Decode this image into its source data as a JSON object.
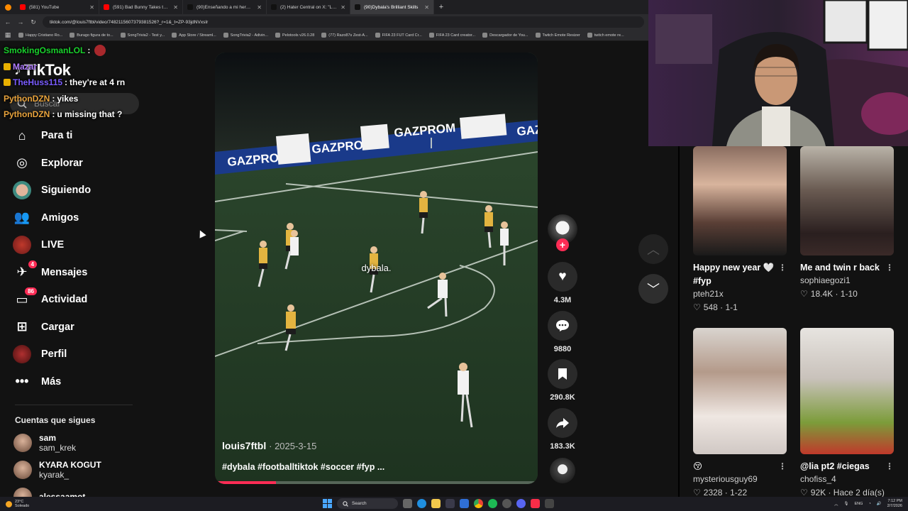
{
  "browser": {
    "tabs": [
      {
        "title": "(581) YouTube",
        "color": "#ff0000"
      },
      {
        "title": "(591) Bad Bunny Takes the Wo",
        "color": "#ff0000"
      },
      {
        "title": "(90)Enseñando a mi hermano a",
        "color": "#111111"
      },
      {
        "title": "(2) Hater Central on X: \"LAMIN",
        "color": "#111111"
      },
      {
        "title": "(90)Dybala's Brilliant Skills",
        "color": "#111111"
      }
    ],
    "url": "tiktok.com/@louis7ftbl/video/7482115607379381526?_r=1&_t=ZP-93jdNVxsIr",
    "bookmarks": [
      "Happy Cristiano Ro...",
      "Burago figura de to...",
      "SongTrivia2 - Test y...",
      "App Store / Streaml...",
      "SongTrivia2 - Adivin...",
      "Pelotools v26.0.28",
      "(77) Razo87s Zest-A...",
      "FIFA 23 FUT Card Cr...",
      "FIFA 23 Card creator...",
      "Descargador de You...",
      "Twitch Emote Resizer",
      "twitch emote re..."
    ]
  },
  "tiktok": {
    "logo": "TikTok",
    "search_placeholder": "Buscar",
    "nav": [
      {
        "label": "Para ti",
        "icon": "home-icon"
      },
      {
        "label": "Explorar",
        "icon": "compass-icon"
      },
      {
        "label": "Siguiendo",
        "icon": "following-avatar-icon"
      },
      {
        "label": "Amigos",
        "icon": "friends-icon"
      },
      {
        "label": "LIVE",
        "icon": "live-icon"
      },
      {
        "label": "Mensajes",
        "icon": "messages-icon",
        "badge": "4"
      },
      {
        "label": "Actividad",
        "icon": "activity-icon",
        "badge": "86"
      },
      {
        "label": "Cargar",
        "icon": "upload-icon"
      },
      {
        "label": "Perfil",
        "icon": "profile-avatar-icon"
      },
      {
        "label": "Más",
        "icon": "more-icon"
      }
    ],
    "following_title": "Cuentas que sigues",
    "following": [
      {
        "name": "sam",
        "handle": "sam_krek"
      },
      {
        "name": "KYARA KOGUT",
        "handle": "kyarak_"
      },
      {
        "name": "alessaamot",
        "handle": ""
      }
    ],
    "video": {
      "author": "louis7ftbl",
      "date": "· 2025-3-15",
      "overlay_text": "dybala.",
      "hashtags": "#dybala #footballtiktok #soccer #fyp ...",
      "progress": 0.19,
      "board_text": "GAZPROM"
    },
    "actions": {
      "likes": "4.3M",
      "comments": "9880",
      "saves": "290.8K",
      "shares": "183.3K"
    },
    "grid": [
      {
        "title": "Happy new year 🤍 #fyp",
        "user": "pteh21x",
        "stats": "548 · 1-1"
      },
      {
        "title": "Me and twin r back",
        "user": "sophiaegozi1",
        "stats": "18.4K · 1-10"
      },
      {
        "title": "😚",
        "user": "mysteriousguy69",
        "stats": "2328 · 1-22"
      },
      {
        "title": "@lia pt2 #ciegas",
        "user": "chofiss_4",
        "stats": "92K · Hace 2 día(s)"
      }
    ]
  },
  "chat": [
    {
      "user": "SmokingOsmanLOL",
      "sep": " :",
      "msg": "",
      "color": "#19d12c",
      "emote": true
    },
    {
      "user": "Mazar",
      "sep": "",
      "msg": "",
      "color": "#b07cff",
      "emote": false
    },
    {
      "user": "TheHuss115",
      "sep": " :",
      "msg": "they're at 4 rn",
      "color": "#7a5cff",
      "emote": false
    },
    {
      "user": "PythonDZN",
      "sep": " :",
      "msg": "yikes",
      "color": "#e8a33d",
      "emote": false
    },
    {
      "user": "PythonDZN",
      "sep": " :",
      "msg": "u missing that ?",
      "color": "#e8a33d",
      "emote": false
    }
  ],
  "taskbar": {
    "weather_temp": "23°C",
    "weather_desc": "Soleado",
    "search_label": "Search",
    "lang": "ENG",
    "time": "7:12 PM",
    "date": "2/7/2026"
  }
}
